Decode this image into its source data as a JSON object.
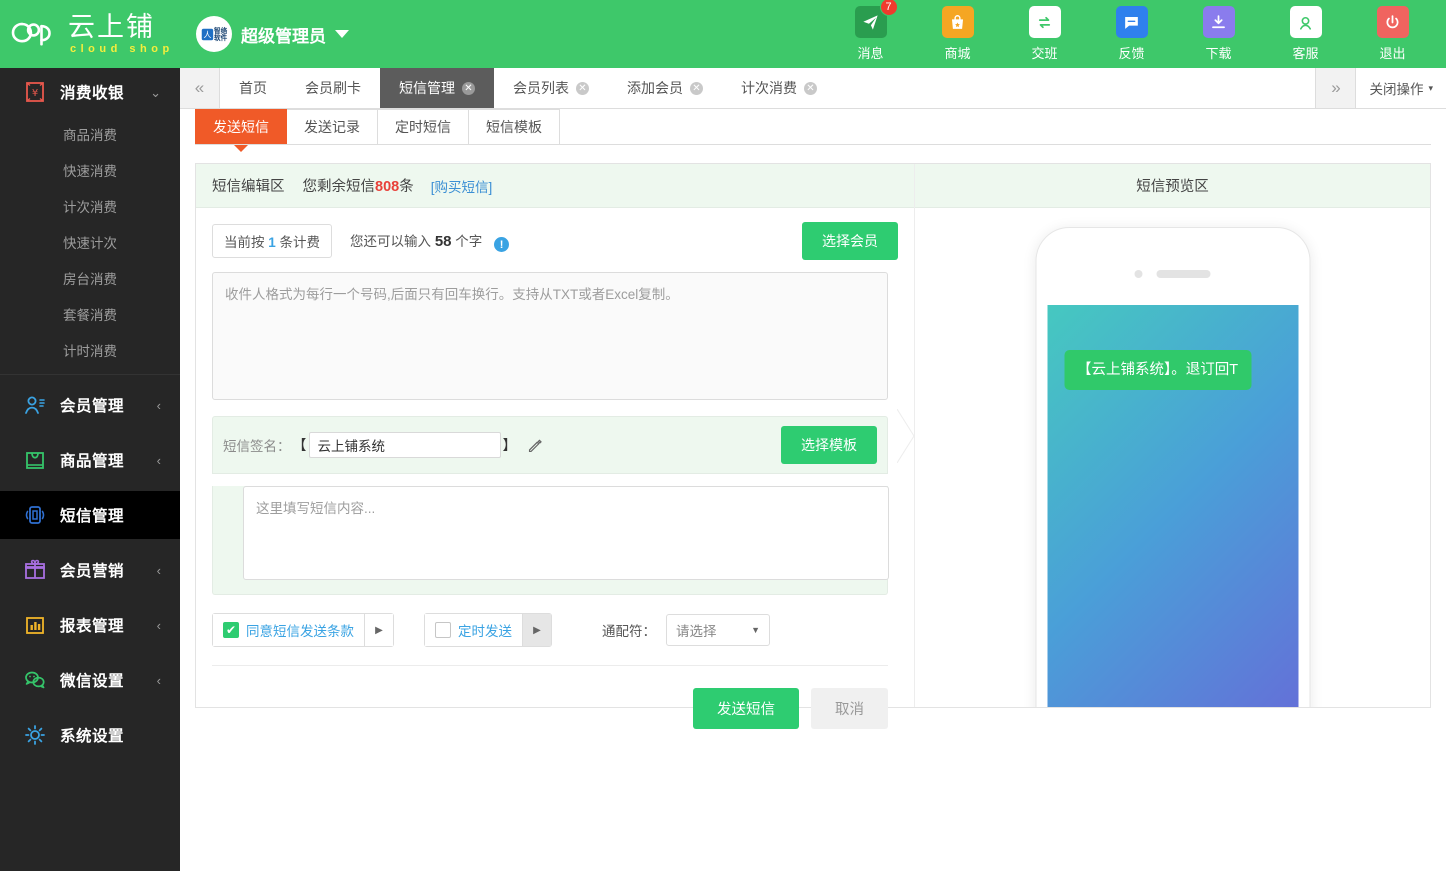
{
  "brand": {
    "name_cn": "云上铺",
    "name_en": "cloud shop",
    "logo_icon": "cloud-shop-logo-icon"
  },
  "header": {
    "avatar_icon": "zhiluo-software-avatar-icon",
    "avatar_badge_cn": "智络",
    "avatar_badge_cn2": "软件",
    "avatar_letter": "人",
    "user_name": "超级管理员",
    "dropdown_icon": "caret-down-icon",
    "tools": [
      {
        "label": "消息",
        "icon": "message-paperplane-icon",
        "badge": "7",
        "color": "#2a9d4f"
      },
      {
        "label": "商城",
        "icon": "shop-bag-icon",
        "badge": "",
        "color": "#f5a623"
      },
      {
        "label": "交班",
        "icon": "shift-exchange-icon",
        "badge": "",
        "color": "#ffffff"
      },
      {
        "label": "反馈",
        "icon": "feedback-chat-icon",
        "badge": "",
        "color": "#2f80ed"
      },
      {
        "label": "下载",
        "icon": "download-icon",
        "badge": "",
        "color": "#8a7ced"
      },
      {
        "label": "客服",
        "icon": "customer-service-icon",
        "badge": "",
        "color": "#ffffff"
      },
      {
        "label": "退出",
        "icon": "power-logout-icon",
        "badge": "",
        "color": "#f0645f"
      }
    ]
  },
  "sidebar": {
    "groups": [
      {
        "label": "消费收银",
        "icon": "cashier-receipt-icon",
        "icon_color": "#e8584d",
        "arrow": "chevron-down-icon",
        "expanded": true,
        "active": false,
        "children": [
          {
            "label": "商品消费"
          },
          {
            "label": "快速消费"
          },
          {
            "label": "计次消费"
          },
          {
            "label": "快速计次"
          },
          {
            "label": "房台消费"
          },
          {
            "label": "套餐消费"
          },
          {
            "label": "计时消费"
          }
        ]
      },
      {
        "label": "会员管理",
        "icon": "member-user-icon",
        "icon_color": "#3aa3e3",
        "arrow": "chevron-left-icon",
        "expanded": false,
        "active": false,
        "children": []
      },
      {
        "label": "商品管理",
        "icon": "goods-box-icon",
        "icon_color": "#35c46a",
        "arrow": "chevron-left-icon",
        "expanded": false,
        "active": false,
        "children": []
      },
      {
        "label": "短信管理",
        "icon": "sms-message-icon",
        "icon_color": "#2f6fd0",
        "arrow": "",
        "expanded": false,
        "active": true,
        "children": []
      },
      {
        "label": "会员营销",
        "icon": "gift-marketing-icon",
        "icon_color": "#a86fe0",
        "arrow": "chevron-left-icon",
        "expanded": false,
        "active": false,
        "children": []
      },
      {
        "label": "报表管理",
        "icon": "report-chart-icon",
        "icon_color": "#f0b429",
        "arrow": "chevron-left-icon",
        "expanded": false,
        "active": false,
        "children": []
      },
      {
        "label": "微信设置",
        "icon": "wechat-icon",
        "icon_color": "#35c46a",
        "arrow": "chevron-left-icon",
        "expanded": false,
        "active": false,
        "children": []
      },
      {
        "label": "系统设置",
        "icon": "gear-settings-icon",
        "icon_color": "#3aa3e3",
        "arrow": "",
        "expanded": false,
        "active": false,
        "children": []
      }
    ]
  },
  "tabstrip": {
    "prev_icon": "double-chevron-left-icon",
    "next_icon": "double-chevron-right-icon",
    "close_ops_label": "关闭操作",
    "close_ops_caret": "caret-down-icon",
    "tabs": [
      {
        "label": "首页",
        "closable": false,
        "active": false
      },
      {
        "label": "会员刷卡",
        "closable": false,
        "active": false
      },
      {
        "label": "短信管理",
        "closable": true,
        "active": true
      },
      {
        "label": "会员列表",
        "closable": true,
        "active": false
      },
      {
        "label": "添加会员",
        "closable": true,
        "active": false
      },
      {
        "label": "计次消费",
        "closable": true,
        "active": false
      }
    ]
  },
  "subtabs": [
    {
      "label": "发送短信",
      "active": true
    },
    {
      "label": "发送记录",
      "active": false
    },
    {
      "label": "定时短信",
      "active": false
    },
    {
      "label": "短信模板",
      "active": false
    }
  ],
  "editor": {
    "head_title": "短信编辑区",
    "remain_prefix": "您剩余短信",
    "remain_count": "808",
    "remain_suffix": "条",
    "buy_link": "[购买短信]",
    "billing_chip_prefix": "当前按",
    "billing_chip_num": "1",
    "billing_chip_suffix": "条计费",
    "count_prefix": "您还可以输入",
    "count_num": "58",
    "count_suffix": "个字",
    "info_icon": "info-exclamation-icon",
    "pick_member_label": "选择会员",
    "recipients_value": "",
    "recipients_placeholder": "收件人格式为每行一个号码,后面只有回车换行。支持从TXT或者Excel复制。",
    "signature_label": "短信签名：",
    "bracket_open": "【",
    "bracket_close": "】",
    "signature_value": "云上铺系统",
    "signature_placeholder": "",
    "edit_icon": "pencil-edit-icon",
    "pick_template_label": "选择模板",
    "content_value": "",
    "content_placeholder": "这里填写短信内容...",
    "agree_checkbox": {
      "label": "同意短信发送条款",
      "checked": true,
      "check_icon": "check-mark-icon",
      "expand_icon": "caret-right-icon"
    },
    "timed_checkbox": {
      "label": "定时发送",
      "checked": false,
      "check_icon": "check-mark-icon",
      "expand_icon": "caret-right-icon"
    },
    "wildcard_label": "通配符：",
    "wildcard_value": "请选择",
    "wildcard_caret": "caret-down-icon",
    "send_label": "发送短信",
    "cancel_label": "取消"
  },
  "preview": {
    "head_title": "短信预览区",
    "phone_icon": "phone-mockup-icon",
    "camera_icon": "phone-camera-icon",
    "speaker_icon": "phone-speaker-icon",
    "message_text": "【云上铺系统】。退订回T"
  },
  "colors": {
    "brand_green": "#3ec86a",
    "accent_orange": "#f05a28",
    "sidebar_bg": "#262626",
    "sidebar_active_bg": "#000000",
    "link_blue": "#3b8fd4",
    "alert_red": "#e8413a",
    "button_green": "#2ecc71",
    "badge_red": "#ef3b2d"
  }
}
